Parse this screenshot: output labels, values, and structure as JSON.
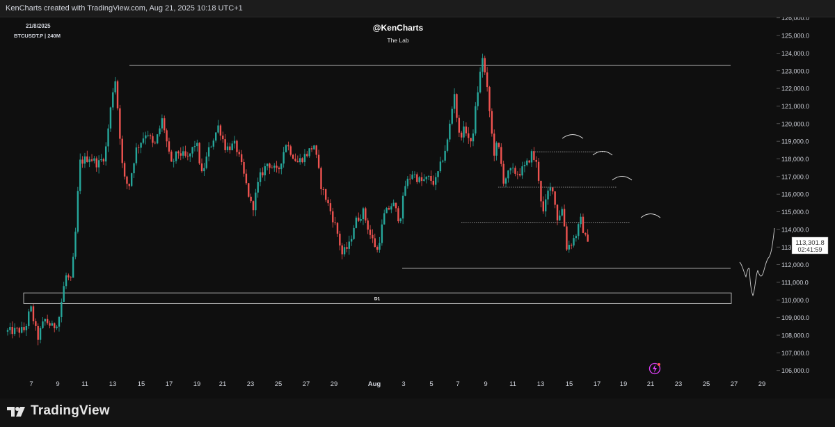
{
  "header": {
    "text": "KenCharts created with TradingView.com, Aug 21, 2025 10:18 UTC+1"
  },
  "chart_info": {
    "date": "21/8/2025",
    "symbol": "BTCUSDT.P | 240M"
  },
  "watermark": {
    "title": "@KenCharts",
    "subtitle": "The Lab"
  },
  "price_label": {
    "price": "113,301.8",
    "countdown": "02:41:59"
  },
  "zone_label": "D1",
  "branding": {
    "name": "TradingView"
  },
  "colors": {
    "up": "#26a69a",
    "down": "#ef5350",
    "background": "#0f0f0f",
    "lines": "#d1d4dc",
    "icon": "#e040fb"
  },
  "chart_data": {
    "type": "candlestick",
    "title": "",
    "symbol": "BTCUSDT.P",
    "timeframe": "240M",
    "yaxis": {
      "ticks": [
        106000,
        107000,
        108000,
        109000,
        110000,
        111000,
        112000,
        113000,
        114000,
        115000,
        116000,
        117000,
        118000,
        119000,
        120000,
        121000,
        122000,
        123000,
        124000,
        125000,
        126000
      ],
      "ylim": [
        105500,
        126300
      ]
    },
    "xaxis": {
      "ticks": [
        "7",
        "9",
        "11",
        "13",
        "15",
        "17",
        "19",
        "21",
        "23",
        "25",
        "27",
        "29",
        "Aug",
        "3",
        "5",
        "7",
        "9",
        "11",
        "13",
        "15",
        "17",
        "19",
        "21",
        "23",
        "25",
        "27",
        "29"
      ]
    },
    "anchors": [
      {
        "d": 0,
        "p": 108200
      },
      {
        "d": 1.4,
        "p": 108300
      },
      {
        "d": 1.8,
        "p": 109600
      },
      {
        "d": 2.3,
        "p": 107800
      },
      {
        "d": 2.8,
        "p": 108900
      },
      {
        "d": 3.4,
        "p": 108400
      },
      {
        "d": 3.8,
        "p": 108900
      },
      {
        "d": 4.3,
        "p": 111400
      },
      {
        "d": 4.7,
        "p": 111000
      },
      {
        "d": 5.0,
        "p": 113800
      },
      {
        "d": 5.3,
        "p": 117800
      },
      {
        "d": 6.0,
        "p": 118100
      },
      {
        "d": 6.6,
        "p": 117700
      },
      {
        "d": 7.1,
        "p": 118200
      },
      {
        "d": 7.8,
        "p": 122800
      },
      {
        "d": 8.1,
        "p": 120000
      },
      {
        "d": 8.4,
        "p": 117000
      },
      {
        "d": 8.8,
        "p": 116400
      },
      {
        "d": 9.3,
        "p": 118500
      },
      {
        "d": 10.1,
        "p": 119600
      },
      {
        "d": 10.6,
        "p": 118600
      },
      {
        "d": 11.2,
        "p": 120300
      },
      {
        "d": 11.8,
        "p": 117600
      },
      {
        "d": 12.3,
        "p": 118400
      },
      {
        "d": 13.0,
        "p": 118000
      },
      {
        "d": 13.6,
        "p": 119000
      },
      {
        "d": 14.0,
        "p": 117100
      },
      {
        "d": 14.5,
        "p": 118500
      },
      {
        "d": 15.2,
        "p": 119900
      },
      {
        "d": 15.7,
        "p": 118600
      },
      {
        "d": 16.4,
        "p": 118800
      },
      {
        "d": 16.9,
        "p": 117400
      },
      {
        "d": 17.6,
        "p": 115100
      },
      {
        "d": 18.1,
        "p": 116900
      },
      {
        "d": 18.7,
        "p": 117800
      },
      {
        "d": 19.4,
        "p": 117200
      },
      {
        "d": 20.0,
        "p": 118900
      },
      {
        "d": 20.8,
        "p": 117800
      },
      {
        "d": 21.5,
        "p": 118300
      },
      {
        "d": 22.0,
        "p": 118800
      },
      {
        "d": 22.5,
        "p": 116500
      },
      {
        "d": 23.1,
        "p": 115200
      },
      {
        "d": 23.6,
        "p": 114000
      },
      {
        "d": 24.0,
        "p": 112600
      },
      {
        "d": 24.5,
        "p": 113100
      },
      {
        "d": 24.9,
        "p": 114400
      },
      {
        "d": 25.5,
        "p": 115000
      },
      {
        "d": 26.0,
        "p": 113700
      },
      {
        "d": 26.5,
        "p": 112800
      },
      {
        "d": 27.0,
        "p": 114800
      },
      {
        "d": 27.6,
        "p": 115500
      },
      {
        "d": 28.1,
        "p": 114500
      },
      {
        "d": 28.5,
        "p": 116500
      },
      {
        "d": 29.0,
        "p": 117200
      },
      {
        "d": 29.6,
        "p": 116700
      },
      {
        "d": 30.2,
        "p": 116900
      },
      {
        "d": 30.6,
        "p": 116600
      },
      {
        "d": 31.0,
        "p": 117600
      },
      {
        "d": 31.5,
        "p": 119000
      },
      {
        "d": 32.0,
        "p": 121800
      },
      {
        "d": 32.3,
        "p": 119300
      },
      {
        "d": 32.8,
        "p": 119700
      },
      {
        "d": 33.2,
        "p": 118700
      },
      {
        "d": 33.6,
        "p": 121500
      },
      {
        "d": 34.0,
        "p": 123800
      },
      {
        "d": 34.4,
        "p": 121500
      },
      {
        "d": 34.8,
        "p": 118300
      },
      {
        "d": 35.1,
        "p": 118900
      },
      {
        "d": 35.5,
        "p": 116800
      },
      {
        "d": 36.0,
        "p": 117300
      },
      {
        "d": 36.6,
        "p": 117200
      },
      {
        "d": 37.1,
        "p": 117600
      },
      {
        "d": 37.5,
        "p": 118300
      },
      {
        "d": 37.9,
        "p": 117600
      },
      {
        "d": 38.3,
        "p": 114800
      },
      {
        "d": 38.7,
        "p": 116200
      },
      {
        "d": 39.0,
        "p": 116400
      },
      {
        "d": 39.3,
        "p": 114600
      },
      {
        "d": 39.7,
        "p": 115200
      },
      {
        "d": 40.0,
        "p": 113000
      },
      {
        "d": 40.4,
        "p": 113300
      },
      {
        "d": 40.7,
        "p": 113800
      },
      {
        "d": 41.0,
        "p": 114500
      },
      {
        "d": 41.4,
        "p": 113300
      }
    ],
    "horizontal_levels": [
      123300,
      118400,
      116400,
      114400,
      111800
    ],
    "zone": {
      "label": "D1",
      "top": 110400,
      "bottom": 109800
    },
    "last_price": 113301.8
  }
}
